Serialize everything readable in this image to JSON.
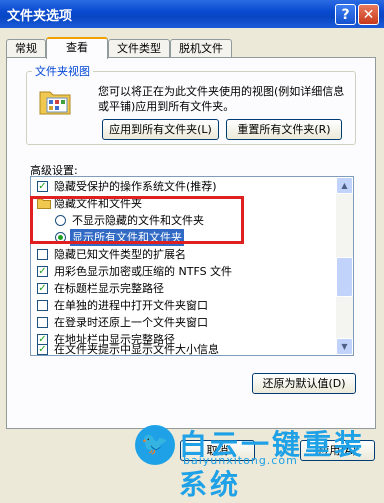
{
  "window": {
    "title": "文件夹选项",
    "help_glyph": "?",
    "close_glyph": "✕"
  },
  "tabs": [
    {
      "label": "常规"
    },
    {
      "label": "查看"
    },
    {
      "label": "文件类型"
    },
    {
      "label": "脱机文件"
    }
  ],
  "folder_views": {
    "label": "文件夹视图",
    "description": "您可以将正在为此文件夹使用的视图(例如详细信息或平铺)应用到所有文件夹。",
    "apply_all_label": "应用到所有文件夹(L)",
    "reset_all_label": "重置所有文件夹(R)"
  },
  "advanced": {
    "label": "高级设置:",
    "items": [
      {
        "label": "隐藏受保护的操作系统文件(推荐)",
        "type": "checkbox",
        "checked": true
      },
      {
        "label": "隐藏文件和文件夹",
        "type": "folder"
      },
      {
        "label": "不显示隐藏的文件和文件夹",
        "type": "radio",
        "checked": false
      },
      {
        "label": "显示所有文件和文件夹",
        "type": "radio",
        "checked": true
      },
      {
        "label": "隐藏已知文件类型的扩展名",
        "type": "checkbox",
        "checked": false
      },
      {
        "label": "用彩色显示加密或压缩的 NTFS 文件",
        "type": "checkbox",
        "checked": true
      },
      {
        "label": "在标题栏显示完整路径",
        "type": "checkbox",
        "checked": true
      },
      {
        "label": "在单独的进程中打开文件夹窗口",
        "type": "checkbox",
        "checked": false
      },
      {
        "label": "在登录时还原上一个文件夹窗口",
        "type": "checkbox",
        "checked": false
      },
      {
        "label": "在地址栏中显示完整路径",
        "type": "checkbox",
        "checked": true
      },
      {
        "label": "在文件夹提示中显示文件大小信息",
        "type": "checkbox",
        "checked": true
      }
    ],
    "restore_defaults_label": "还原为默认值(D)"
  },
  "footer": {
    "cancel_label": "取消",
    "apply_label": "应用(A)"
  },
  "watermark": {
    "text": "白云一键重装系统",
    "url": "baiyunxitong.com"
  },
  "colors": {
    "title_bar": "#0a4ad0",
    "selection": "#316ac5",
    "highlight_box": "#e02020",
    "watermark": "#1ea1e6"
  }
}
